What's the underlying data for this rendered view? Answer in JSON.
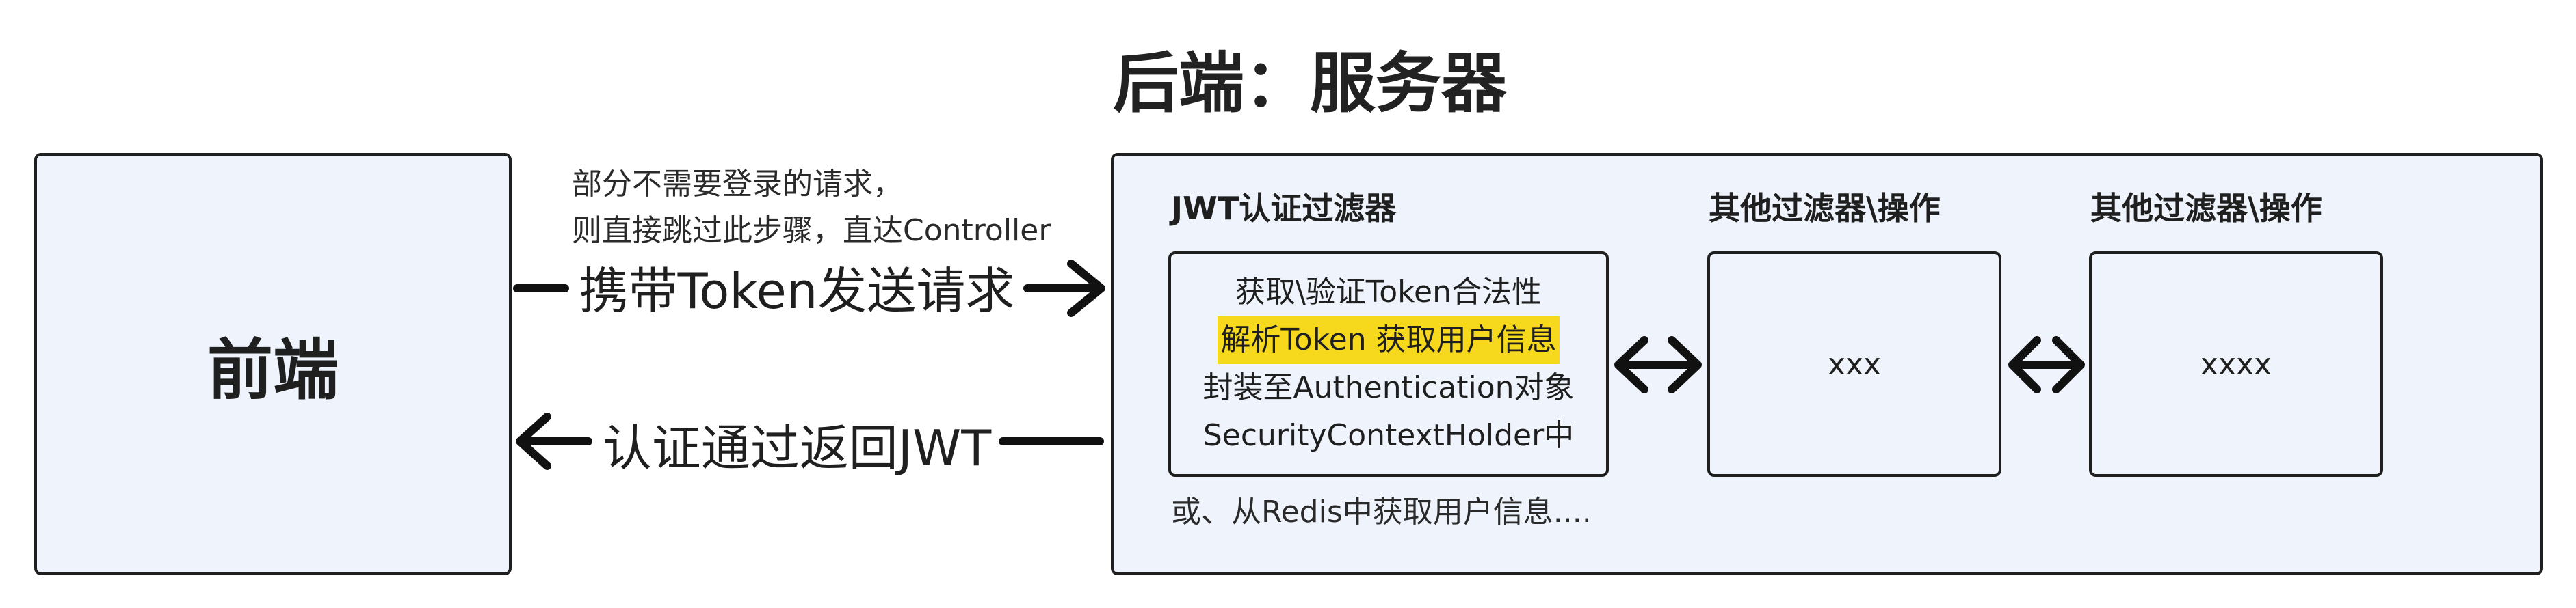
{
  "diagram": {
    "title": "后端：服务器",
    "frontend": {
      "label": "前端"
    },
    "note": {
      "line1": "部分不需要登录的请求，",
      "line2": "则直接跳过此步骤，直达Controller"
    },
    "request_arrow_label": "携带Token发送请求",
    "response_arrow_label": "认证通过返回JWT",
    "jwt_filter": {
      "title": "JWT认证过滤器",
      "lines": [
        "获取\\验证Token合法性",
        "解析Token 获取用户信息",
        "封装至Authentication对象",
        "SecurityContextHolder中"
      ],
      "highlight_color": "#f6d91c"
    },
    "redis_note": "或、从Redis中获取用户信息....",
    "other_filter_1": {
      "title": "其他过滤器\\操作",
      "label": "xxx"
    },
    "other_filter_2": {
      "title": "其他过滤器\\操作",
      "label": "xxxx"
    },
    "colors": {
      "box_fill": "#eef3fc",
      "stroke": "#1f1f1f",
      "highlight": "#f6d91c"
    }
  }
}
